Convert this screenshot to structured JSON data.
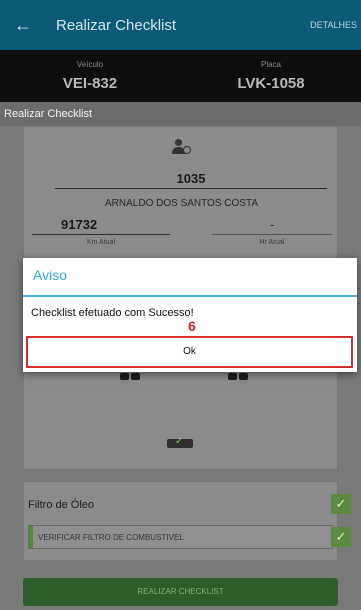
{
  "appbar": {
    "title": "Realizar Checklist",
    "action": "DETALHES",
    "back_icon": "arrow-back-icon",
    "color": "#0b5a78"
  },
  "vehicle": {
    "veiculo_label": "Veículo",
    "veiculo_value": "VEI-832",
    "placa_label": "Placa",
    "placa_value": "LVK-1058"
  },
  "section": {
    "title": "Realizar Checklist"
  },
  "form": {
    "driver_icon": "driver-icon",
    "driver_code": "1035",
    "driver_name": "ARNALDO DOS SANTOS COSTA",
    "km_value": "91732",
    "km_label": "Km Atual",
    "hr_value": "-",
    "hr_label": "Hr Atual",
    "truck_icon": "truck-check-icon"
  },
  "filtro": {
    "title": "Filtro de Óleo",
    "item_label": "VERIFICAR FILTRO DE COMBUSTIVEL",
    "check_icon": "check-icon",
    "accent": "#5c8a3e"
  },
  "submit": {
    "label": "REALIZAR CHECKLIST"
  },
  "dialog": {
    "title": "Aviso",
    "message": "Checklist efetuado com Sucesso!",
    "annotation": "6",
    "ok_label": "Ok",
    "title_color": "#2aa6d6",
    "highlight_color": "#d32d2f"
  }
}
